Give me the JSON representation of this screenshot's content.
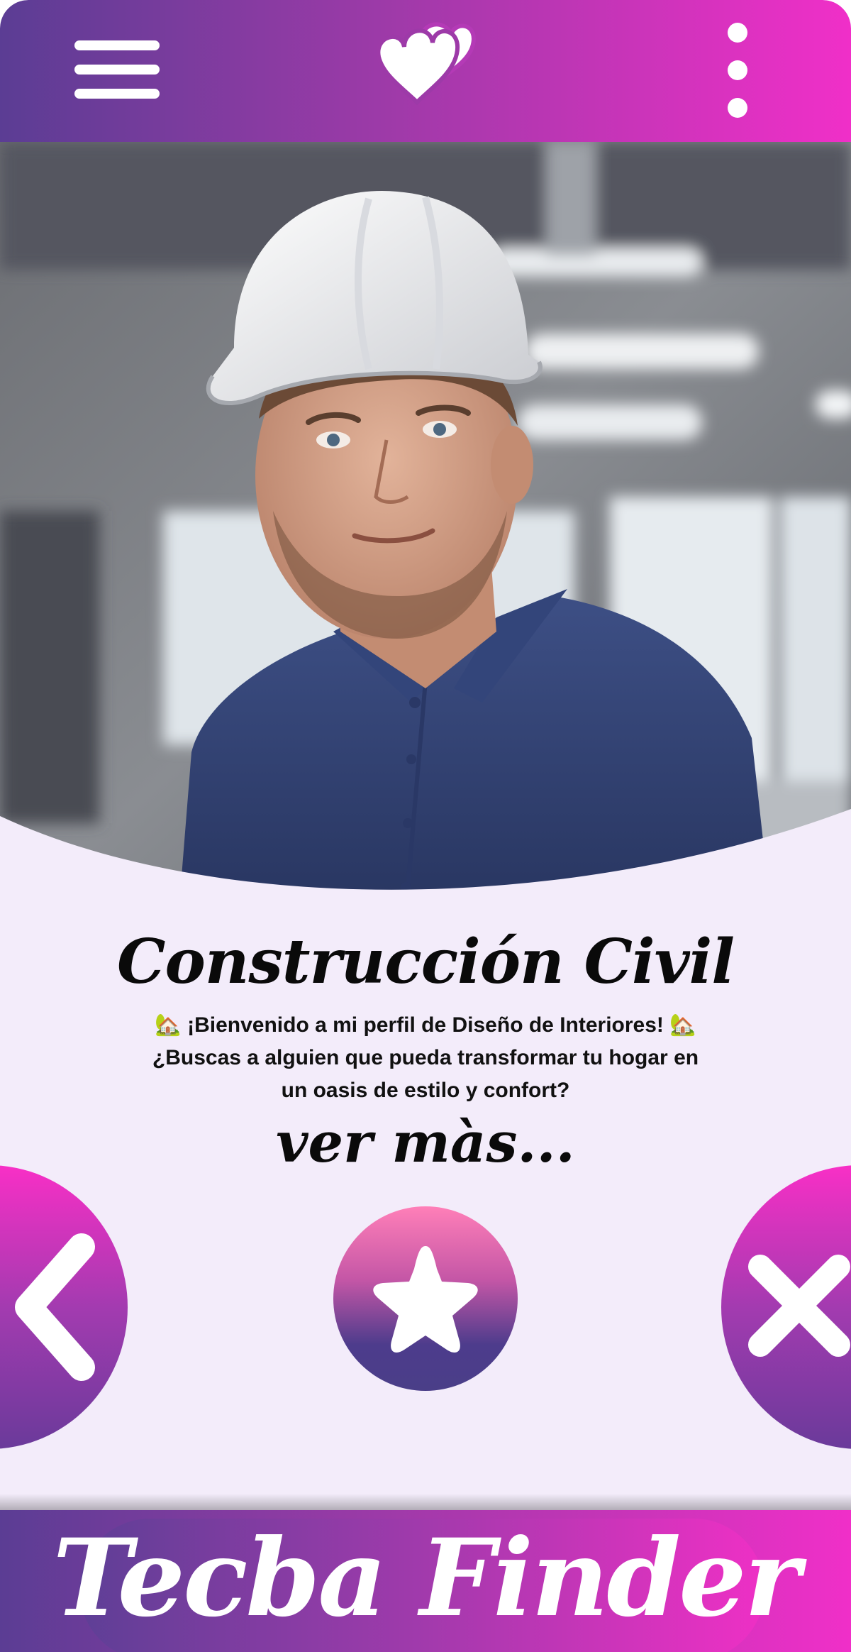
{
  "app": {
    "brand": "Tecba Finder",
    "colors": {
      "gradient_start": "#5b3d94",
      "gradient_end": "#f02fc8",
      "background": "#f3ecfa"
    }
  },
  "header": {
    "menu_icon": "hamburger-menu-icon",
    "logo_icon": "double-heart-icon",
    "more_icon": "vertical-dots-icon"
  },
  "profile": {
    "photo_icon": "profile-photo",
    "title": "Construcción Civil",
    "description": "🏡 ¡Bienvenido a mi perfil de Diseño de Interiores! 🏡 ¿Buscas a alguien que pueda transformar tu hogar en un oasis de estilo y confort?",
    "see_more": "ver màs..."
  },
  "actions": {
    "back_icon": "chevron-left-icon",
    "favorite_icon": "star-icon",
    "dismiss_icon": "close-icon"
  },
  "footer": {
    "brand_label": "Tecba Finder"
  }
}
